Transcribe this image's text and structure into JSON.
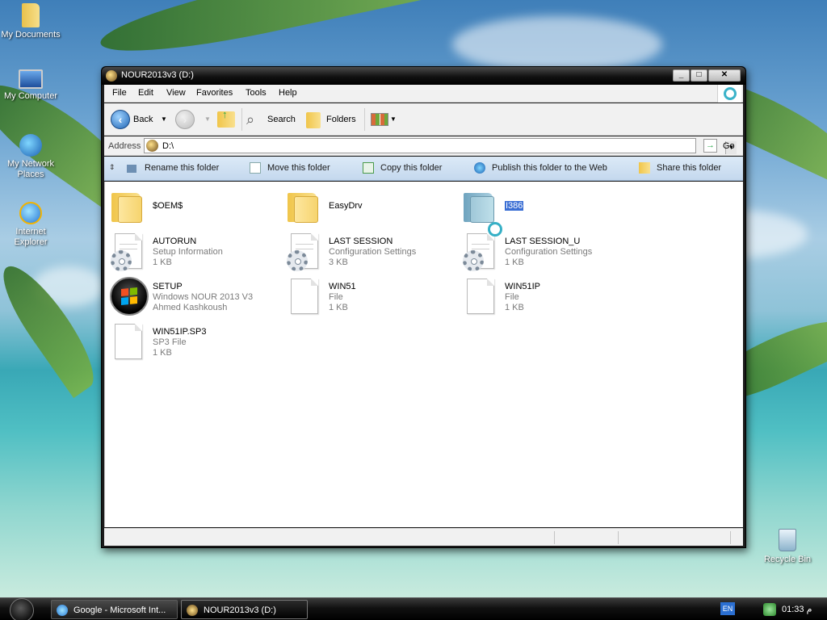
{
  "desktop": {
    "icons": [
      {
        "label": "My Documents",
        "icon": "my-documents-icon"
      },
      {
        "label": "My Computer",
        "icon": "my-computer-icon"
      },
      {
        "label": "My Network Places",
        "icon": "network-places-icon"
      },
      {
        "label": "Internet Explorer",
        "icon": "internet-explorer-icon"
      }
    ],
    "recycle_bin": "Recycle Bin"
  },
  "window": {
    "title": "NOUR2013v3 (D:)",
    "caption_buttons": {
      "minimize": "_",
      "maximize": "□",
      "close": "✕"
    },
    "menu": [
      "File",
      "Edit",
      "View",
      "Favorites",
      "Tools",
      "Help"
    ],
    "toolbar": {
      "back": "Back",
      "search": "Search",
      "folders": "Folders"
    },
    "address": {
      "label": "Address",
      "value": "D:\\",
      "go": "Go"
    },
    "tasks": [
      {
        "label": "Rename this folder",
        "icon": "rename-icon"
      },
      {
        "label": "Move this folder",
        "icon": "move-icon"
      },
      {
        "label": "Copy this folder",
        "icon": "copy-icon"
      },
      {
        "label": "Publish this folder to the Web",
        "icon": "publish-web-icon"
      },
      {
        "label": "Share this folder",
        "icon": "share-icon"
      }
    ],
    "files": [
      {
        "name": "$OEM$",
        "type": "",
        "size": "",
        "kind": "folder"
      },
      {
        "name": "EasyDrv",
        "type": "",
        "size": "",
        "kind": "folder"
      },
      {
        "name": "I386",
        "type": "",
        "size": "",
        "kind": "folder-selected"
      },
      {
        "name": "AUTORUN",
        "type": "Setup Information",
        "size": "1 KB",
        "kind": "config"
      },
      {
        "name": "LAST SESSION",
        "type": "Configuration Settings",
        "size": "3 KB",
        "kind": "config"
      },
      {
        "name": "LAST SESSION_U",
        "type": "Configuration Settings",
        "size": "1 KB",
        "kind": "config"
      },
      {
        "name": "SETUP",
        "type": "Windows NOUR 2013 V3",
        "size": "Ahmed Kashkoush",
        "kind": "setup"
      },
      {
        "name": "WIN51",
        "type": "File",
        "size": "1 KB",
        "kind": "doc"
      },
      {
        "name": "WIN51IP",
        "type": "File",
        "size": "1 KB",
        "kind": "doc"
      },
      {
        "name": "WIN51IP.SP3",
        "type": "SP3 File",
        "size": "1 KB",
        "kind": "doc"
      }
    ]
  },
  "taskbar": {
    "buttons": [
      {
        "label": "Google - Microsoft Int...",
        "icon": "internet-explorer-icon"
      },
      {
        "label": "NOUR2013v3 (D:)",
        "icon": "drive-icon"
      }
    ],
    "language": "EN",
    "clock": "01:33 م"
  }
}
